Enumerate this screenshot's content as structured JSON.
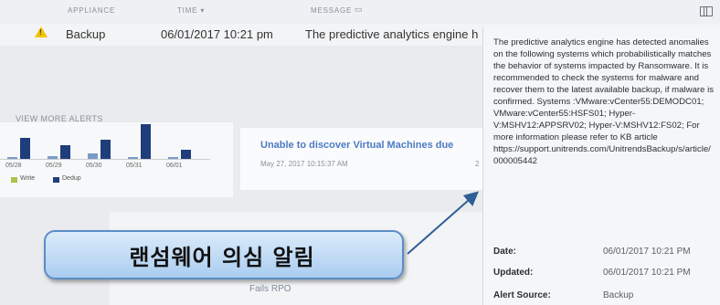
{
  "alerts_table": {
    "headers": [
      "APPLIANCE",
      "TIME",
      "MESSAGE"
    ],
    "sort_indicator": "▾",
    "rows": [
      {
        "appliance": "Backup",
        "time": "06/01/2017 10:21 pm",
        "message": "The predictive analytics engine h"
      }
    ],
    "view_more": "VIEW MORE ALERTS"
  },
  "chart_data": {
    "type": "bar",
    "categories": [
      "05/28",
      "05/29",
      "05/30",
      "05/31",
      "06/01"
    ],
    "series": [
      {
        "name": "Write",
        "values": [
          0.05,
          0.08,
          0.15,
          0.05,
          0.05
        ],
        "color": "#7a9bc8"
      },
      {
        "name": "Dedup",
        "values": [
          0.6,
          0.4,
          0.55,
          1.0,
          0.25
        ],
        "color": "#1f3d7a"
      }
    ],
    "legend": [
      "Write",
      "Dedup"
    ],
    "legend_placement": "bottom-left"
  },
  "message_card": {
    "title": "Unable to discover Virtual Machines due",
    "time": "May 27, 2017 10:15:37 AM",
    "page": "2"
  },
  "lower": {
    "status_text": "Fails RPO"
  },
  "tooltip": {
    "body": "The predictive analytics engine has detected anomalies on the following systems which probabilistically matches the behavior of systems impacted by Ransomware. It is recommended to check the systems for malware and recover them to the latest available backup, if malware is confirmed. Systems :VMware:vCenter55:DEMODC01; VMware:vCenter55:HSFS01; Hyper-V:MSHV12:APPSRV02; Hyper-V:MSHV12:FS02; For more information please refer to KB article https://support.unitrends.com/UnitrendsBackup/s/article/000005442",
    "date_label": "Date:",
    "date_value": "06/01/2017 10:21 PM",
    "updated_label": "Updated:",
    "updated_value": "06/01/2017 10:21 PM",
    "source_label": "Alert Source:",
    "source_value": "Backup"
  },
  "callout": {
    "text": "랜섬웨어 의심 알림"
  },
  "icons": {
    "warning": "warning-icon",
    "columns": "columns-icon"
  },
  "colors": {
    "accent_link": "#4c7bc4",
    "warning": "#f2c400",
    "callout_border": "#5c8cc6",
    "arrow": "#2f5d96"
  }
}
